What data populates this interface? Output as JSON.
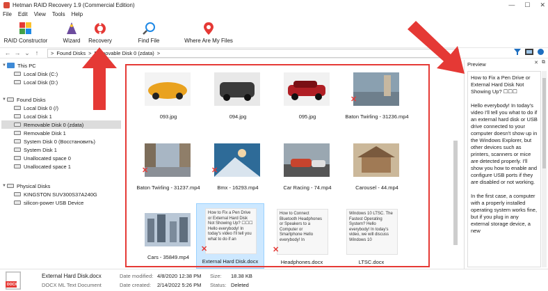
{
  "window": {
    "title": "Hetman RAID Recovery 1.9 (Commercial Edition)",
    "minimize": "—",
    "maximize": "☐",
    "close": "✕"
  },
  "menu": [
    "File",
    "Edit",
    "View",
    "Tools",
    "Help"
  ],
  "toolbar": {
    "raid_constructor": "RAID Constructor",
    "wizard": "Wizard",
    "recovery": "Recovery",
    "find_file": "Find File",
    "where_are_my_files": "Where Are My Files"
  },
  "address": {
    "segments": [
      "Found Disks",
      "Removable Disk 0 (zdata)"
    ],
    "separator": ">"
  },
  "tree": {
    "this_pc": "This PC",
    "this_pc_items": [
      "Local Disk (C:)",
      "Local Disk (D:)"
    ],
    "found_disks": "Found Disks",
    "found_items": [
      "Local Disk 0 (/)",
      "Local Disk 1",
      "Removable Disk 0 (zdata)",
      "Removable Disk 1",
      "System Disk 0 (Восстановить)",
      "System Disk 1",
      "Unallocated space 0",
      "Unallocated space 1"
    ],
    "physical_disks": "Physical Disks",
    "physical_items": [
      "KINGSTON SUV300S37A240G",
      "silicon-power USB Device"
    ]
  },
  "files": [
    {
      "label": "093.jpg",
      "kind": "image",
      "color": "#e9a21f",
      "deleted": false
    },
    {
      "label": "094.jpg",
      "kind": "image",
      "color": "#3a3a3a",
      "deleted": false
    },
    {
      "label": "095.jpg",
      "kind": "image",
      "color": "#b01e24",
      "deleted": false
    },
    {
      "label": "Baton Twirling - 31236.mp4",
      "kind": "video",
      "color": "#6e7f8c",
      "deleted": true
    },
    {
      "label": "Baton Twirling - 31237.mp4",
      "kind": "video",
      "color": "#8a9aa6",
      "deleted": true
    },
    {
      "label": "Bmx - 16293.mp4",
      "kind": "video",
      "color": "#2e6b98",
      "deleted": true
    },
    {
      "label": "Car Racing - 74.mp4",
      "kind": "video",
      "color": "#c8442e",
      "deleted": false
    },
    {
      "label": "Carousel - 44.mp4",
      "kind": "video",
      "color": "#7a5a3e",
      "deleted": false
    },
    {
      "label": "Cars - 35849.mp4",
      "kind": "video",
      "color": "#8696aa",
      "deleted": false
    },
    {
      "label": "External Hard Disk.docx",
      "kind": "doc",
      "deleted": true,
      "selected": true,
      "text": "How to Fix a Pen Drive or External Hard Disk Not Showing Up? ☐☐☐  Hello everybody! In today's video I'll tell you what to do if an"
    },
    {
      "label": "Headphones.docx",
      "kind": "doc",
      "deleted": true,
      "text": "How to Connect Bluetooth Headphones or Speakers to a Computer or Smartphone  Hello everybody! In"
    },
    {
      "label": "LTSC.docx",
      "kind": "doc",
      "deleted": false,
      "text": "Windows 10 LTSC. The Fastest Operating System?  Hello everybody! In today's video, we will discuss Windows 10"
    }
  ],
  "preview": {
    "title": "Preview",
    "text": "How to Fix a Pen Drive or External Hard Disk Not Showing Up? ☐☐☐\n\nHello everybody! In today's video I'll tell you what to do if an external hard disk or USB drive connected to your computer doesn't show up in the Windows Explorer, but other devices such as printers, scanners or mice are detected properly. I'll show you how to enable and configure USB ports if they are disabled or not working.\n\nIn the first case, a computer with a properly installed operating system works fine, but if you plug in any external storage device, a new"
  },
  "status": {
    "filename": "External Hard Disk.docx",
    "filetype": "DOCX ML Text Document",
    "date_modified_label": "Date modified:",
    "date_modified": "4/8/2020 12:38 PM",
    "date_created_label": "Date created:",
    "date_created": "2/14/2022 5:26 PM",
    "size_label": "Size:",
    "size": "18.38 KB",
    "status_label": "Status:",
    "status": "Deleted",
    "icon_label": "DOCX"
  },
  "colors": {
    "accent_red": "#e53935",
    "selection": "#cde8ff",
    "tree_selection": "#dcdcdc"
  }
}
